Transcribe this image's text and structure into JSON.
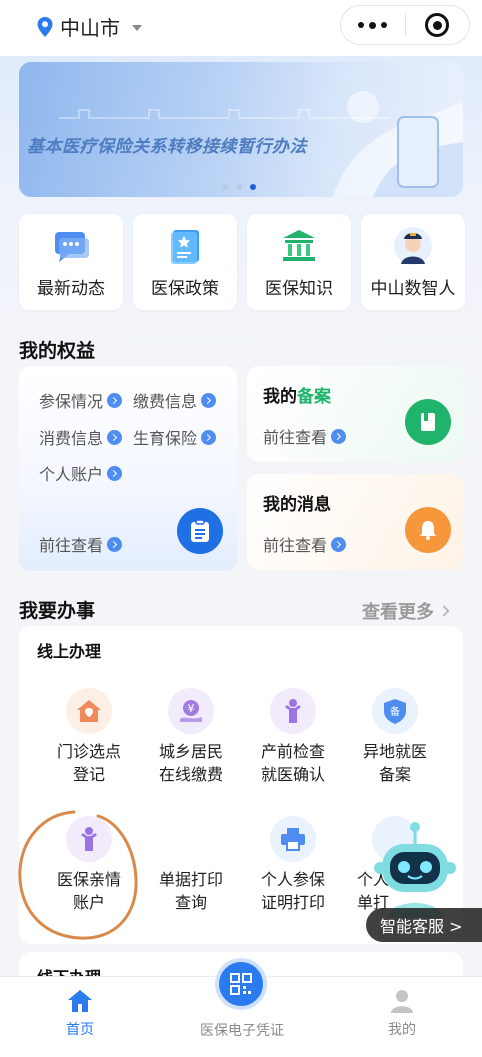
{
  "header": {
    "city": "中山市",
    "icons": [
      "location-pin-icon",
      "caret-down-icon",
      "more-dots-icon",
      "target-icon"
    ]
  },
  "banner": {
    "title": "基本医疗保险关系转移接续暂行办法",
    "slides": 3,
    "active_slide": 3
  },
  "quick_entries": [
    {
      "label": "最新动态",
      "icon": "news-chat-icon"
    },
    {
      "label": "医保政策",
      "icon": "policy-book-icon"
    },
    {
      "label": "医保知识",
      "icon": "knowledge-building-icon"
    },
    {
      "label": "中山数智人",
      "icon": "digital-human-avatar-icon"
    }
  ],
  "rights": {
    "title": "我的权益",
    "items": [
      "参保情况",
      "缴费信息",
      "消费信息",
      "生育保险",
      "个人账户"
    ],
    "go": "前往查看"
  },
  "record": {
    "title_prefix": "我的",
    "title_highlight": "备案",
    "go": "前往查看"
  },
  "messages": {
    "title": "我的消息",
    "go": "前往查看"
  },
  "services": {
    "title": "我要办事",
    "more": "查看更多",
    "online_title": "线上办理",
    "items": [
      {
        "line1": "门诊选点",
        "line2": "登记",
        "icon": "clinic-house-icon"
      },
      {
        "line1": "城乡居民",
        "line2": "在线缴费",
        "icon": "payment-yuan-icon"
      },
      {
        "line1": "产前检查",
        "line2": "就医确认",
        "icon": "pregnancy-person-icon"
      },
      {
        "line1": "异地就医",
        "line2": "备案",
        "icon": "record-shield-icon"
      },
      {
        "line1": "医保亲情",
        "line2": "账户",
        "icon": "family-person-icon"
      },
      {
        "line1": "单据打印",
        "line2": "查询",
        "icon": "document-icon"
      },
      {
        "line1": "个人参保",
        "line2": "证明打印",
        "icon": "printer-icon"
      },
      {
        "line1": "个人",
        "line2": "单打",
        "icon": "print-icon"
      }
    ],
    "offline_title": "线下办理"
  },
  "customer_service": {
    "label": "智能客服 >"
  },
  "tabbar": {
    "home": "首页",
    "voucher": "医保电子凭证",
    "mine": "我的"
  },
  "colors": {
    "primary": "#2a7af0",
    "green": "#1fb36b",
    "orange": "#f5973a",
    "annotation": "#d98a4a"
  }
}
